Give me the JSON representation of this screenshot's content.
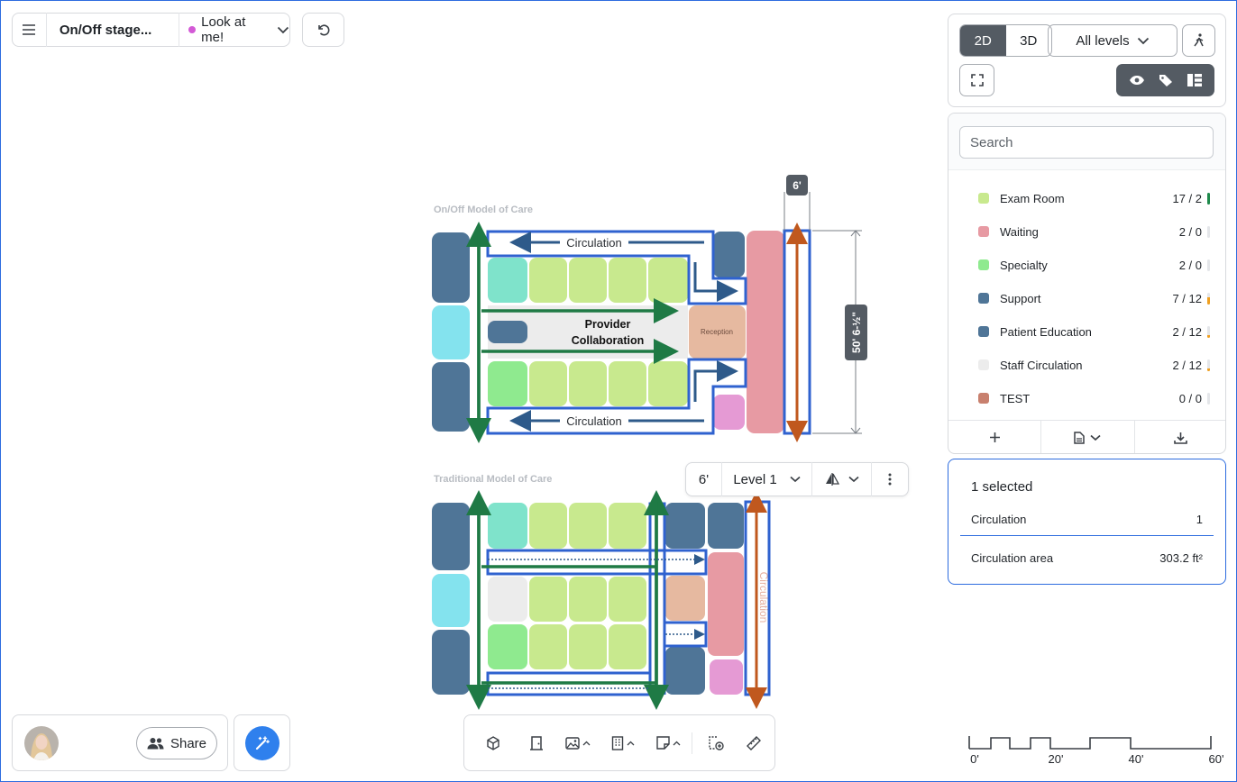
{
  "project": {
    "title": "On/Off stage...",
    "status_label": "Look at me!",
    "status_color": "#d35ad6"
  },
  "view": {
    "mode_2d": "2D",
    "mode_3d": "3D",
    "active_mode": "2D",
    "levels_label": "All levels"
  },
  "legend": {
    "search_placeholder": "Search",
    "items": [
      {
        "name": "Exam Room",
        "count": "17 / 2",
        "color": "#c8e98e",
        "fill": 1.0,
        "bar_color": "#1f8a4c"
      },
      {
        "name": "Waiting",
        "count": "2 / 0",
        "color": "#e79aa3",
        "fill": 0.0,
        "bar_color": "#e4e6e9"
      },
      {
        "name": "Specialty",
        "count": "2 / 0",
        "color": "#8fea8f",
        "fill": 0.0,
        "bar_color": "#e4e6e9"
      },
      {
        "name": "Support",
        "count": "7 / 12",
        "color": "#4f7597",
        "fill": 0.58,
        "bar_color": "#f0a020"
      },
      {
        "name": "Patient Education",
        "count": "2 / 12",
        "color": "#4f7597",
        "fill": 0.17,
        "bar_color": "#f0a020"
      },
      {
        "name": "Staff Circulation",
        "count": "2 / 12",
        "color": "#ececec",
        "fill": 0.17,
        "bar_color": "#f0a020"
      },
      {
        "name": "TEST",
        "count": "0 / 0",
        "color": "#c8806e",
        "fill": 0.0,
        "bar_color": "#e4e6e9"
      }
    ]
  },
  "selection": {
    "title": "1 selected",
    "row1_label": "Circulation",
    "row1_value": "1",
    "row2_label": "Circulation area",
    "row2_value": "303.2 ft²"
  },
  "canvas": {
    "top_plan_title": "On/Off Model of Care",
    "bottom_plan_title": "Traditional Model of Care",
    "circulation_label": "Circulation",
    "collab_line1": "Provider",
    "collab_line2": "Collaboration",
    "reception_label": "Reception",
    "width_dim": "6'",
    "height_dim": "50' 6-½\"",
    "vertical_circ_label": "Circulation"
  },
  "context_bar": {
    "dimension": "6'",
    "level": "Level 1"
  },
  "user": {
    "share_label": "Share"
  },
  "scale": {
    "ticks": [
      "0'",
      "20'",
      "40'",
      "60'"
    ]
  }
}
